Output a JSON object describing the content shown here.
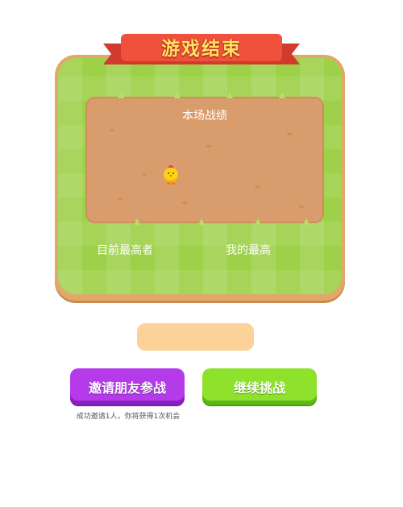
{
  "header": {
    "title": "游戏结束"
  },
  "board": {
    "stats_title": "本场战绩",
    "labels": {
      "top_scorer": "目前最高者",
      "my_best": "我的最高"
    }
  },
  "score": {
    "value": ""
  },
  "actions": {
    "invite_label": "邀请朋友参战",
    "continue_label": "继续挑战",
    "invite_hint": "成功邀请1人，你将获得1次机会"
  },
  "icons": {
    "character": "chick-icon"
  },
  "colors": {
    "ribbon": "#f0513d",
    "title_text": "#ffe165",
    "grass": "#9ed14a",
    "dirt": "#d99c6c",
    "invite_button": "#b53bea",
    "continue_button": "#8ee22c",
    "score_pill": "#fdd299"
  }
}
